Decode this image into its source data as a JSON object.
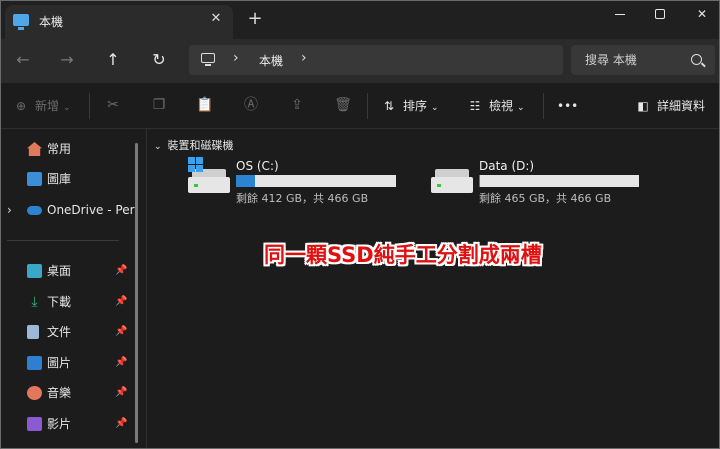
{
  "tab": {
    "title": "本機"
  },
  "address": {
    "location": "本機",
    "separator": "›"
  },
  "search": {
    "placeholder": "搜尋 本機"
  },
  "commandbar": {
    "new_label": "新增",
    "sort_label": "排序",
    "view_label": "檢視",
    "more_label": "•••",
    "details_label": "詳細資料"
  },
  "sidebar": {
    "items": [
      {
        "label": "常用",
        "icon": "home-icon"
      },
      {
        "label": "圖庫",
        "icon": "gallery-icon"
      },
      {
        "label": "OneDrive - Per",
        "icon": "cloud-icon"
      },
      {
        "label": "桌面",
        "icon": "desktop-icon"
      },
      {
        "label": "下載",
        "icon": "download-icon"
      },
      {
        "label": "文件",
        "icon": "document-icon"
      },
      {
        "label": "圖片",
        "icon": "pictures-icon"
      },
      {
        "label": "音樂",
        "icon": "music-icon"
      },
      {
        "label": "影片",
        "icon": "videos-icon"
      }
    ]
  },
  "content": {
    "group_header": "裝置和磁碟機",
    "drives": [
      {
        "name": "OS (C:)",
        "info": "剩餘 412 GB，共 466 GB",
        "used_fraction": 0.116
      },
      {
        "name": "Data (D:)",
        "info": "剩餘 465 GB，共 466 GB",
        "used_fraction": 0.002
      }
    ]
  },
  "annotation": "同一顆SSD純手工分割成兩槽",
  "colors": {
    "accent": "#2a84d2",
    "annotation": "#e01010",
    "background": "#1c1c1c"
  }
}
